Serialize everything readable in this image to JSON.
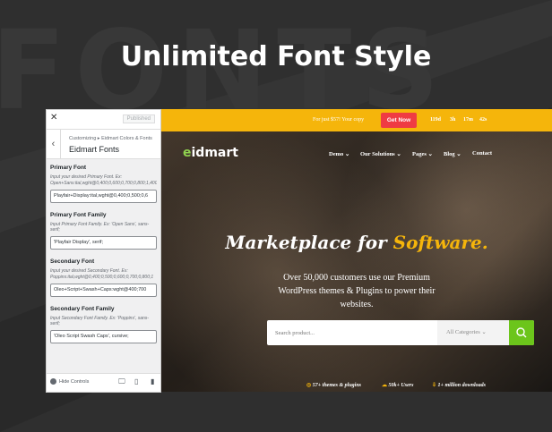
{
  "background": {
    "word": "FONTS",
    "headline": "Unlimited Font Style"
  },
  "customizer": {
    "close_icon": "close-icon",
    "published_label": "Published",
    "breadcrumb": "Customizing ▸ Eidmart Colors & Fonts",
    "section_title": "Eidmart Fonts",
    "fields": [
      {
        "label": "Primary Font",
        "description": "Input your desired Primary Font. Ex: Open+Sans:ital,wght@0,400;0,600;0,700;0,800;1,400",
        "value": "Playfair+Display:ital,wght@0,400;0,500;0,6"
      },
      {
        "label": "Primary Font Family",
        "description": "Input Primary Font Family. Ex: 'Open Sans', sans-serif;",
        "value": "'Playfair Display', serif;"
      },
      {
        "label": "Secondary Font",
        "description": "Input your desired Secondary Font. Ex: Poppins:ital,wght@0,400;0,500;0,600;0,700;0,800;1",
        "value": "Oleo+Script+Swash+Caps:wght@400;700"
      },
      {
        "label": "Secondary Font Family",
        "description": "Input Secondary Font Family. Ex: 'Poppins', sans-serif;",
        "value": "'Oleo Script Swash Caps', cursive;"
      }
    ],
    "hide_controls": "Hide Controls"
  },
  "site": {
    "promo_text": "For just $57! Your copy",
    "get_now": "Get Now",
    "countdown": [
      "119d",
      "3h",
      "17m",
      "42s"
    ],
    "logo_prefix": "e",
    "logo_rest": "idmart",
    "nav": [
      "Demo ⌄",
      "Our Solutions ⌄",
      "Pages ⌄",
      "Blog ⌄",
      "Contact"
    ],
    "hero_title_a": "Marketplace for ",
    "hero_title_b": "Software.",
    "hero_subtitle": "Over 50,000 customers use our Premium WordPress themes & Plugins to power their websites.",
    "search_placeholder": "Search product...",
    "category_select": "All Categories",
    "stats": [
      "57+ themes & plugins",
      "50k+ Users",
      "1+ million downloads"
    ],
    "colors": {
      "accent": "#f5b50b",
      "cta": "#ef3b43",
      "search_button": "#6cc51b"
    }
  }
}
